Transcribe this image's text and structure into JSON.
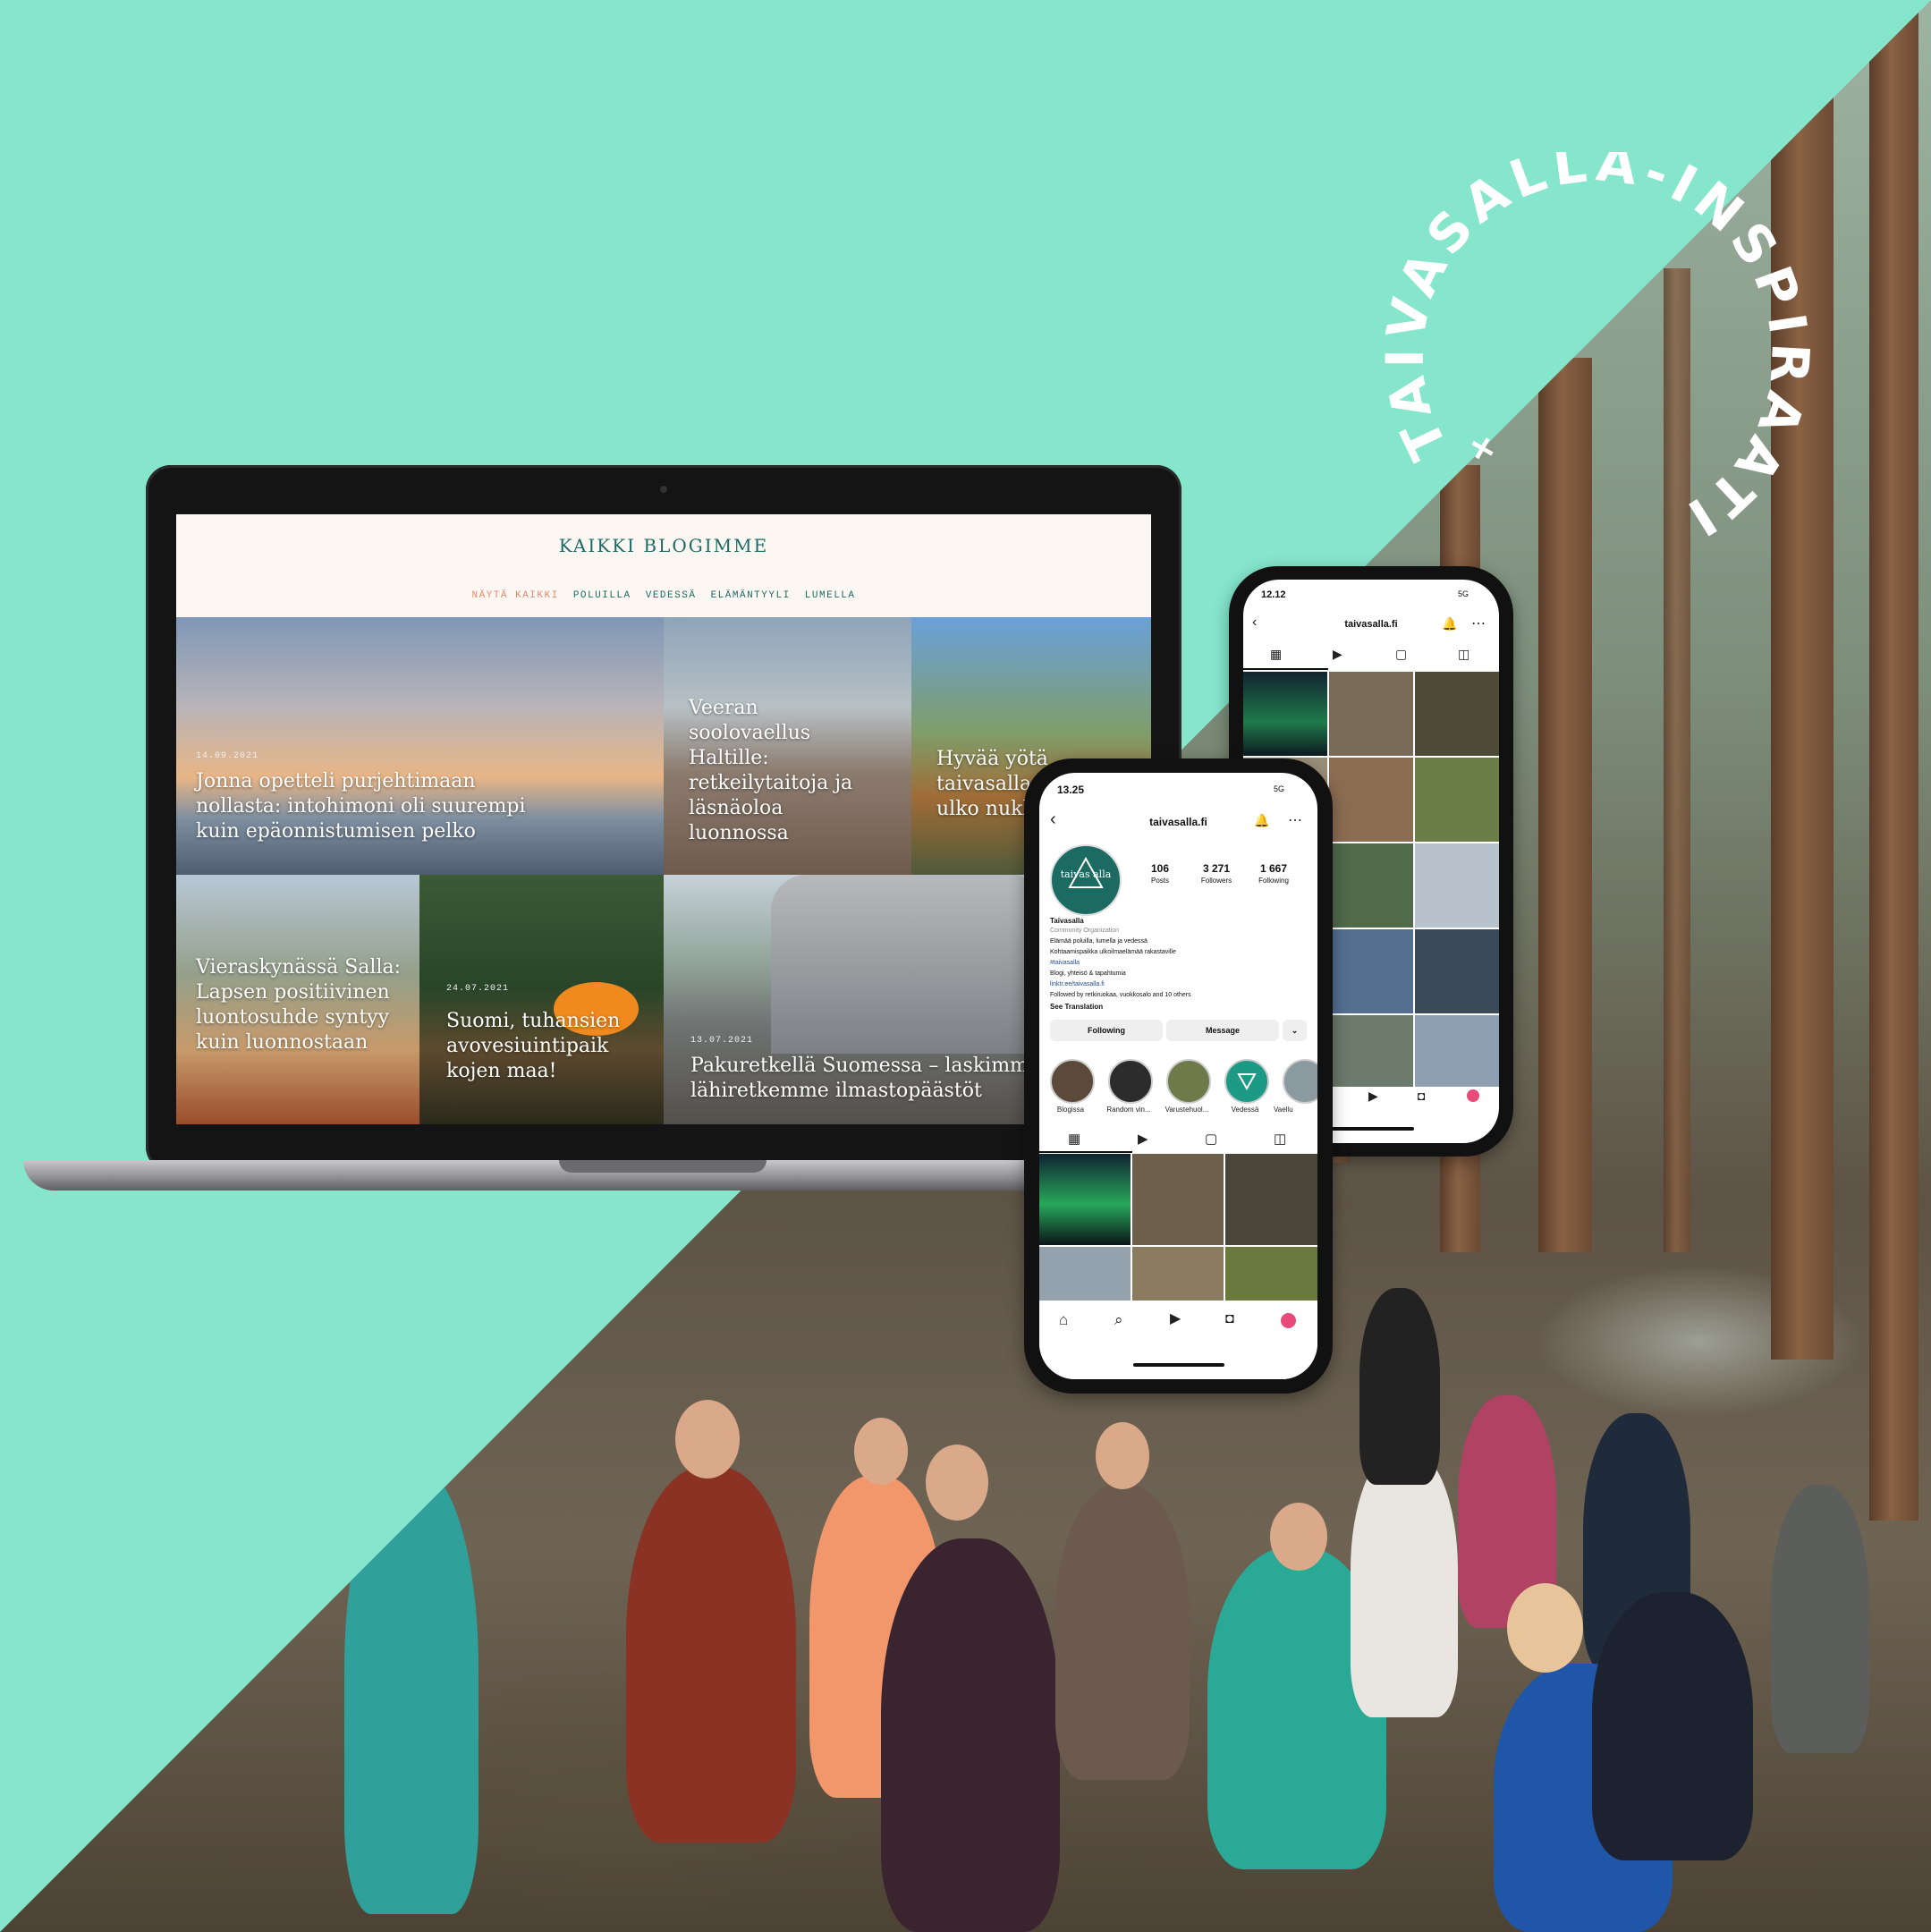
{
  "badge": {
    "arc_text": "TAIVASALLA-INSPIRAATIO",
    "separator": "+"
  },
  "blog": {
    "title": "KAIKKI BLOGIMME",
    "nav": [
      "NÄYTÄ KAIKKI",
      "POLUILLA",
      "VEDESSÄ",
      "ELÄMÄNTYYLI",
      "LUMELLA"
    ],
    "posts": [
      {
        "date": "14.09.2021",
        "title": "Jonna opetteli purjehtimaan nollasta: intohimoni oli suurempi kuin epäonnistumisen pelko"
      },
      {
        "date": "",
        "title": "Veeran soolovaellus Haltille: retkeilytaitoja ja läsnäoloa luonnossa"
      },
      {
        "date": "",
        "title": "Hyvää yötä taivasalla – vinkit ulko nukkumis"
      },
      {
        "date": "",
        "title": "Vieraskynässä Salla: Lapsen positiivinen luontosuhde syntyy kuin luonnostaan"
      },
      {
        "date": "24.07.2021",
        "title": "Suomi, tuhansien avovesiuintipaik kojen maa!"
      },
      {
        "date": "13.07.2021",
        "title": "Pakuretkellä Suomessa – laskimme lähiretkemme ilmastopäästöt"
      }
    ]
  },
  "phone_back": {
    "time": "12.12",
    "signal": "5G",
    "username": "taivasalla.fi"
  },
  "phone_front": {
    "time": "13.25",
    "signal": "5G",
    "username": "taivasalla.fi",
    "avatar_text": "taivas alla",
    "stats": [
      {
        "value": "106",
        "label": "Posts"
      },
      {
        "value": "3 271",
        "label": "Followers"
      },
      {
        "value": "1 667",
        "label": "Following"
      }
    ],
    "profile_name": "Taivasalla",
    "category": "Community Organization",
    "bio_lines": [
      "Elämää poluilla, lumella ja vedessä",
      "Kohtaamispaikka ulkoilmaelämää rakastaville",
      "#taivasalla",
      "Blogi, yhteisö & tapahtumia",
      "linktr.ee/taivasalla.fi",
      "Followed by retkiruokaa, vuokkosalo and 10 others"
    ],
    "see_translation": "See Translation",
    "following_label": "Following",
    "message_label": "Message",
    "highlights": [
      "Blogissa",
      "Random vin...",
      "Varustehuol...",
      "Vedessä",
      "Vaellu"
    ]
  },
  "colors": {
    "mint": "#85e6cb",
    "teal": "#1c6b63",
    "coral": "#e48b6e"
  }
}
